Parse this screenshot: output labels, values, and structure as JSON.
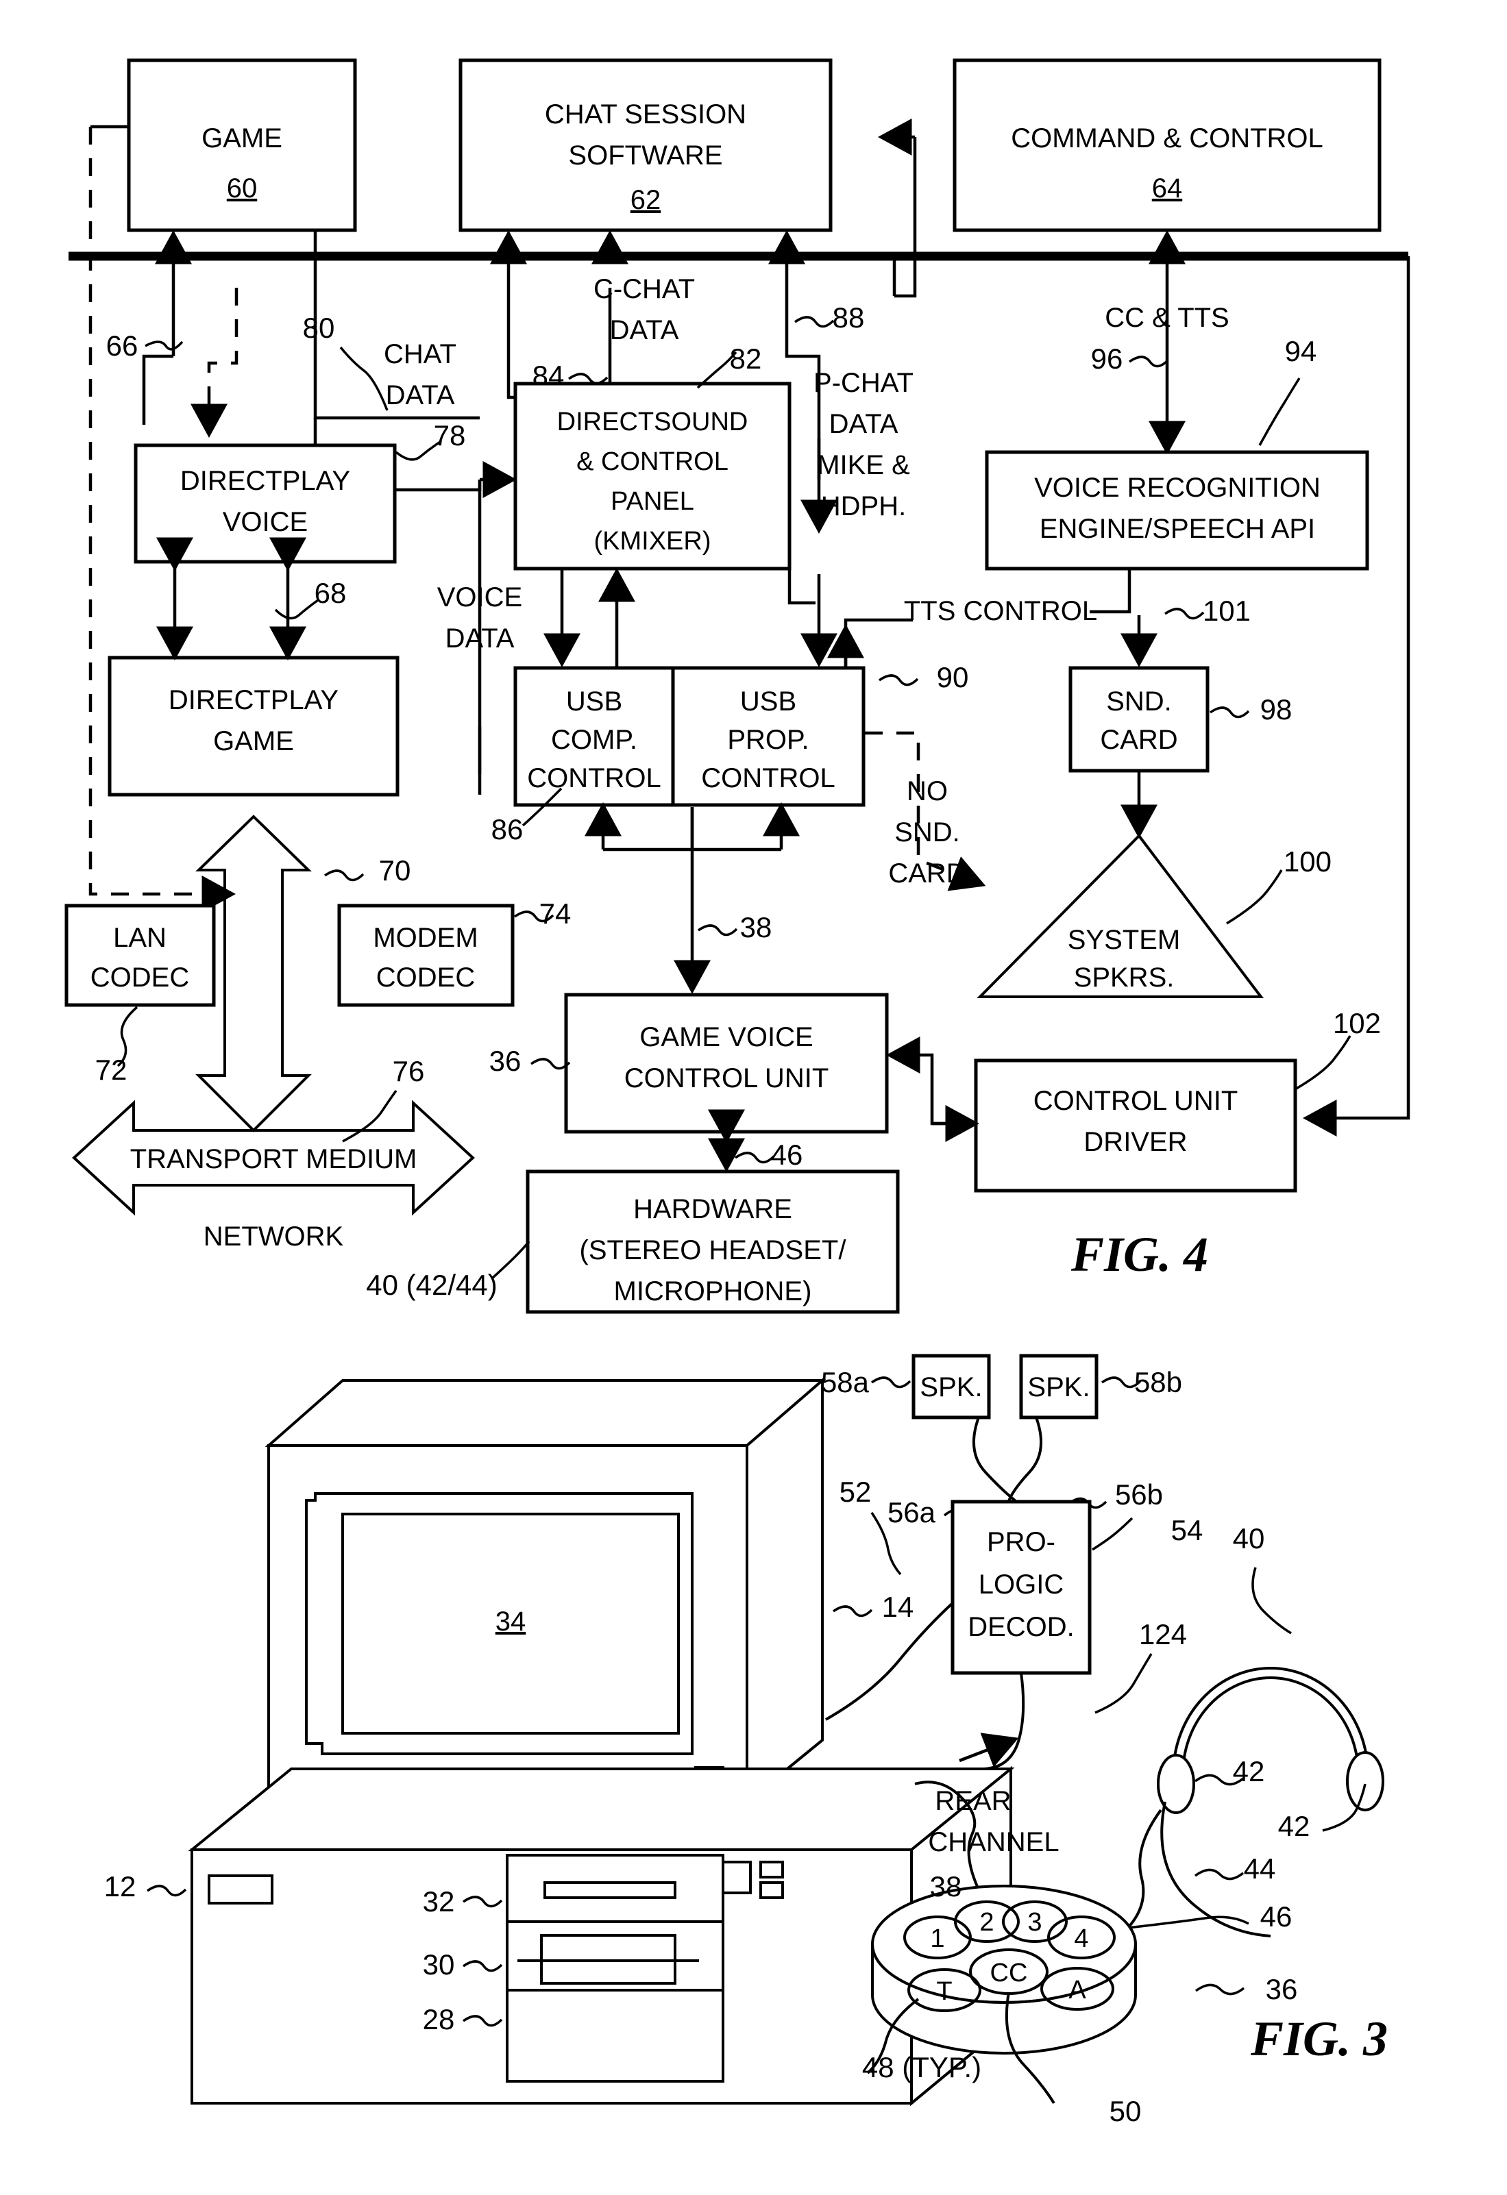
{
  "figure4": {
    "caption": "FIG. 4",
    "boxes": {
      "game": {
        "line1": "GAME",
        "ref": "60"
      },
      "chat_session": {
        "line1": "CHAT SESSION",
        "line2": "SOFTWARE",
        "ref": "62"
      },
      "command_control": {
        "line1": "COMMAND & CONTROL",
        "ref": "64"
      },
      "directplay_voice": {
        "line1": "DIRECTPLAY",
        "line2": "VOICE",
        "ref": "78"
      },
      "directplay_game": {
        "line1": "DIRECTPLAY",
        "line2": "GAME",
        "ref": "68"
      },
      "directsound": {
        "line1": "DIRECTSOUND",
        "line2": "& CONTROL",
        "line3": "PANEL",
        "line4": "(KMIXER)",
        "ref": "82"
      },
      "voice_recognition": {
        "line1": "VOICE RECOGNITION",
        "line2": "ENGINE/SPEECH API",
        "ref": "94"
      },
      "usb_comp": {
        "line1": "USB",
        "line2": "COMP.",
        "line3": "CONTROL",
        "ref": "86"
      },
      "usb_prop": {
        "line1": "USB",
        "line2": "PROP.",
        "line3": "CONTROL",
        "ref": "90"
      },
      "snd_card": {
        "line1": "SND.",
        "line2": "CARD",
        "ref": "98"
      },
      "lan_codec": {
        "line1": "LAN",
        "line2": "CODEC",
        "ref": "72"
      },
      "modem_codec": {
        "line1": "MODEM",
        "line2": "CODEC",
        "ref": "74"
      },
      "system_spkrs": {
        "line1": "SYSTEM",
        "line2": "SPKRS.",
        "ref": "100"
      },
      "game_voice_control_unit": {
        "line1": "GAME VOICE",
        "line2": "CONTROL UNIT",
        "ref": "36"
      },
      "control_unit_driver": {
        "line1": "CONTROL UNIT",
        "line2": "DRIVER",
        "ref": "102"
      },
      "hardware": {
        "line1": "HARDWARE",
        "line2": "(STEREO HEADSET/",
        "line3": "MICROPHONE)",
        "ref": "40 (42/44)"
      },
      "transport_medium": {
        "line1": "TRANSPORT MEDIUM",
        "sub": "NETWORK",
        "ref": "76"
      }
    },
    "signal_labels": {
      "chat_data": {
        "line1": "CHAT",
        "line2": "DATA",
        "ref": "80"
      },
      "c_chat_data": {
        "line1": "C-CHAT",
        "line2": "DATA",
        "ref": "84"
      },
      "p_chat_data": {
        "line1": "P-CHAT",
        "line2": "DATA",
        "line3": "MIKE &",
        "line4": "HDPH.",
        "ref": "88"
      },
      "cc_tts": {
        "line1": "CC & TTS",
        "ref": "96"
      },
      "voice_data": {
        "line1": "VOICE",
        "line2": "DATA"
      },
      "tts_control": {
        "line1": "TTS CONTROL",
        "ref": "101"
      },
      "no_snd_card": {
        "line1": "NO",
        "line2": "SND.",
        "line3": "CARD"
      },
      "bus_ref": "66",
      "arrow_70_ref": "70",
      "link_38_ref": "38",
      "link_46_ref": "46"
    }
  },
  "figure3": {
    "caption": "FIG. 3",
    "labels": {
      "monitor_screen": "34",
      "monitor": "14",
      "chassis": "12",
      "drive_32": "32",
      "drive_30": "30",
      "drive_28": "28",
      "cable_52": "52",
      "decoder": {
        "line1": "PRO-",
        "line2": "LOGIC",
        "line3": "DECOD.",
        "ref": "54"
      },
      "spk_left": {
        "label": "SPK.",
        "ref": "58a"
      },
      "spk_right": {
        "label": "SPK.",
        "ref": "58b"
      },
      "spk_wire_left": "56a",
      "spk_wire_right": "56b",
      "rear_channel": {
        "line1": "REAR",
        "line2": "CHANNEL",
        "ref": "124"
      },
      "headset": "40",
      "earphone_1": "42",
      "earphone_2": "42",
      "microphone": "44",
      "headset_cable": "46",
      "puck": "36",
      "puck_cable": "38",
      "puck_buttons_ref": "48 (TYP.)",
      "cc_button_ref": "50",
      "buttons": [
        "1",
        "2",
        "3",
        "4",
        "T",
        "CC",
        "A"
      ]
    }
  }
}
